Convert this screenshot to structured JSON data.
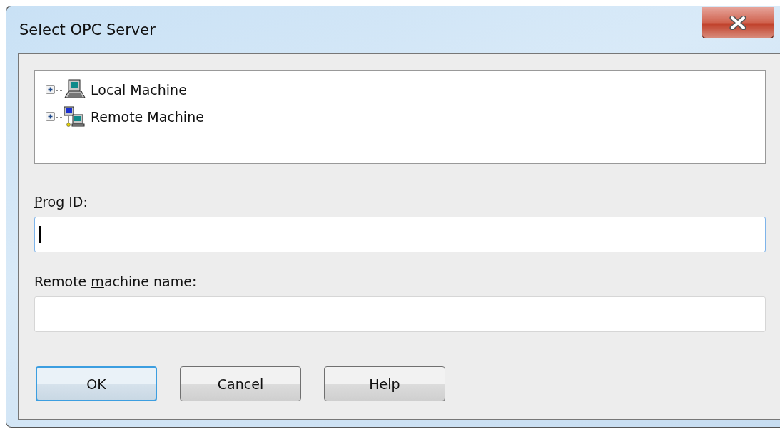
{
  "window": {
    "title": "Select OPC Server"
  },
  "tree": {
    "items": [
      {
        "label": "Local Machine",
        "kind": "computer",
        "expanded": false
      },
      {
        "label": "Remote Machine",
        "kind": "network",
        "expanded": false
      }
    ]
  },
  "fields": [
    {
      "label": {
        "key": "P",
        "after": "rog ID:"
      },
      "focused": true
    },
    {
      "label": {
        "before": "Remote ",
        "key": "m",
        "after": "achine name:"
      },
      "focused": false
    }
  ],
  "buttons": [
    {
      "label": "OK",
      "default": true
    },
    {
      "label": "Cancel",
      "default": false
    },
    {
      "label": "Help",
      "default": false
    }
  ]
}
